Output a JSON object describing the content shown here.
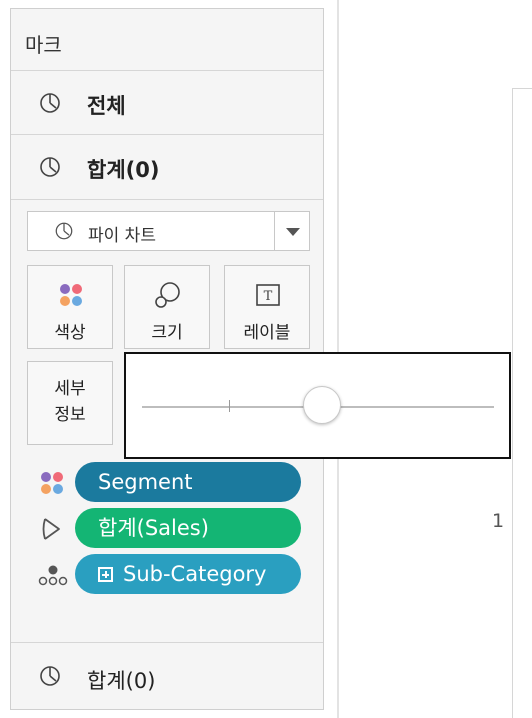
{
  "marks_card": {
    "title": "마크",
    "all_row": {
      "label": "전체",
      "icon": "pie-chart-icon"
    },
    "sum_row": {
      "label": "합계(0)",
      "icon": "pie-chart-icon"
    },
    "mark_type": {
      "label": "파이 차트",
      "icon": "pie-chart-icon"
    },
    "buttons": {
      "color": {
        "label": "색상",
        "icon": "color-dots-icon"
      },
      "size": {
        "label": "크기",
        "icon": "size-circles-icon"
      },
      "label": {
        "label": "레이블",
        "icon": "text-label-icon"
      },
      "detail": {
        "label": "세부\n정보",
        "line1": "세부",
        "line2": "정보"
      }
    },
    "pills": [
      {
        "icon": "color-dots-icon",
        "label": "Segment",
        "color": "#1b7a9e"
      },
      {
        "icon": "angle-icon",
        "label": "합계(Sales)",
        "color": "#14b574"
      },
      {
        "icon": "detail-dots-icon",
        "label": "Sub-Category",
        "color": "#2a9fc0"
      }
    ],
    "bottom_row": {
      "label": "합계(0)",
      "icon": "pie-chart-icon"
    }
  },
  "canvas": {
    "row_number": "1"
  },
  "size_slider": {
    "value_fraction": 0.51
  },
  "colors": {
    "dot_purple": "#8a6bbf",
    "dot_pink": "#f06a78",
    "dot_orange": "#f4a261",
    "dot_blue": "#6aa9e0"
  }
}
